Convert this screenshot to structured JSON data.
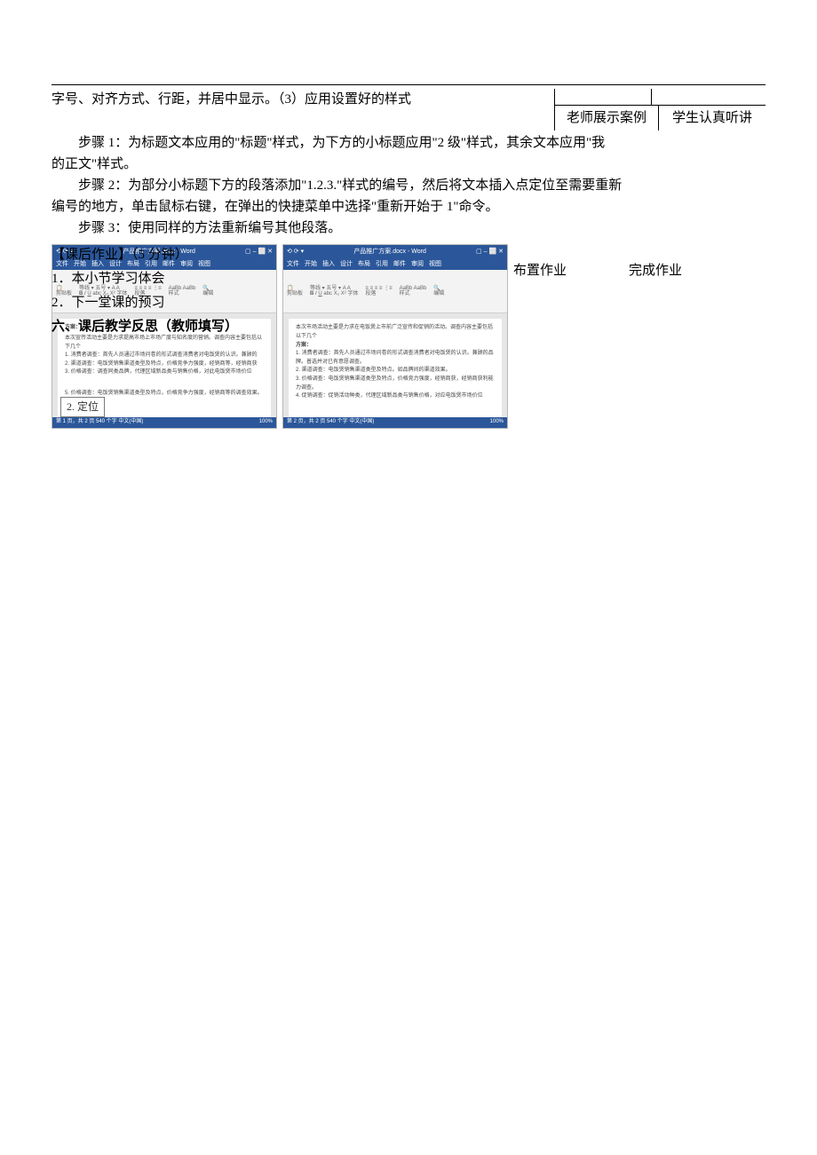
{
  "topline": "字号、对齐方式、行距，并居中显示。（3）应用设置好的样式",
  "box": {
    "teacher": "老师展示案例",
    "student": "学生认真听讲"
  },
  "steps": {
    "s1a": "步骤 1：为标题文本应用的\"标题\"样式，为下方的小标题应用\"2 级\"样式，其余文本应用\"我",
    "s1b": "的正文\"样式。",
    "s2a": "步骤 2：为部分小标题下方的段落添加\"1.2.3.\"样式的编号，然后将文本插入点定位至需要重新",
    "s2b": "编号的地方，单击鼠标右键，在弹出的快捷菜单中选择\"重新开始于 1\"命令。",
    "s3": "步骤 3：使用同样的方法重新编号其他段落。"
  },
  "fg": {
    "hw_title": "【课后作业】（5 分钟）",
    "hw1": "1．本小节学习体会",
    "hw2": "2．下一堂课的预习",
    "reflect": "六、课后教学反思（教师填写）"
  },
  "hw_box": {
    "assign": "布置作业",
    "finish": "完成作业"
  },
  "callout": "2. 定位",
  "word": {
    "doc_title": "产品推广方案.docx - Word",
    "tabs": [
      "文件",
      "开始",
      "插入",
      "设计",
      "布局",
      "引用",
      "邮件",
      "审阅",
      "视图"
    ],
    "status_left_1": "第 1 页，共 2 页  540 个字  中文(中国)",
    "status_left_2": "第 2 页，共 2 页  540 个字  中文(中国)",
    "status_right": "100%",
    "doc1_title": "方案：",
    "doc1_l1": "本次宣传活动主要是力求提高市场上市场广度与知名度的营销。调查内容主要包括以下几个",
    "doc1_l2": "1. 消费者调查：首先人员通过市场问卷的形式调查消费者对电饭煲的认识。兼顾的",
    "doc1_l3": "2. 渠道调查：电饭煲销售渠道类型及特点，价格竞争力强度，经销商等，经销商获",
    "doc1_l4": "3. 价格调查：调查同类品牌，代理区域新品类与销售价格，对此电饭煲市场价位",
    "doc1_p5": "5.  价格调查：电饭煲销售渠道类型及特点，价格竞争力强度，经销商等的调查效果。",
    "doc2_intro": "本次市场活动主要是力求在电饭煲上市前广泛宣传和促销的活动。调查内容主要包括以下几个",
    "doc2_sub": "方案：",
    "doc2_l1": "1. 消费者调查：首先人员通过市场问卷的形式调查消费者对电饭煲的认识。兼顾的品牌。普选并对已有意愿调查。",
    "doc2_l2": "2. 渠道调查：电饭煲销售渠道类型及特点。如品牌间的渠道效果。",
    "doc2_l3": "3. 价格调查：电饭煲销售渠道类型及特点，价格竞力强度，经销商获，经销商获利能力调查。",
    "doc2_l4": "4.  促销调查：促销活动种类，代理区域新品类与销售价格，对应电饭煲市场价位"
  }
}
